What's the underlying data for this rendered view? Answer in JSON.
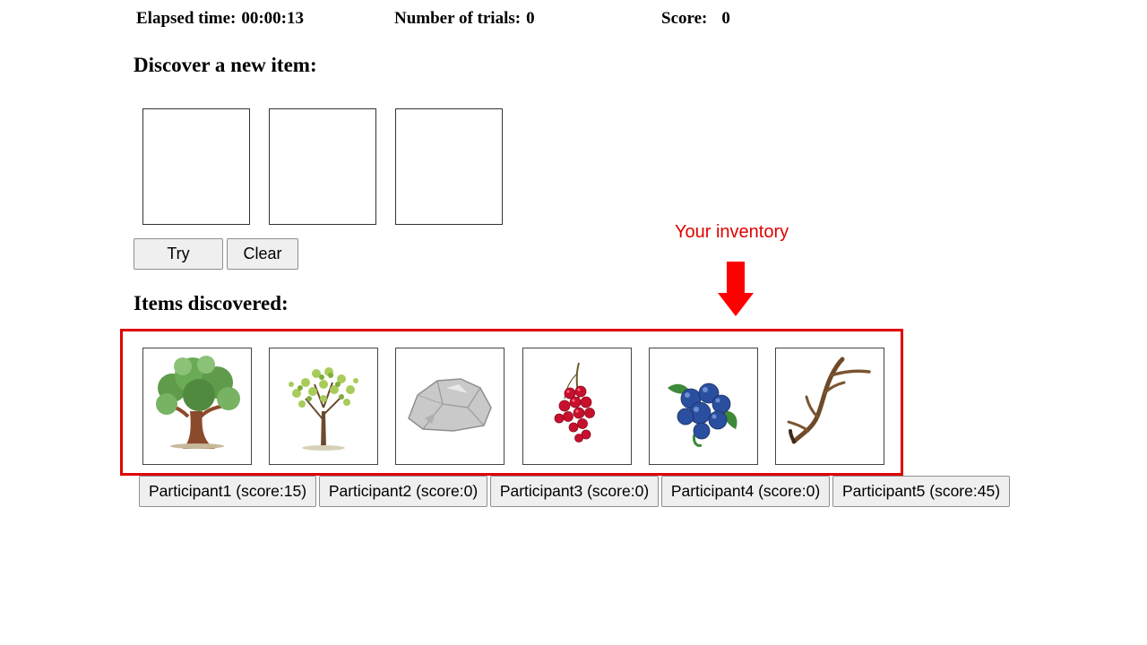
{
  "stats": {
    "elapsed_label": "Elapsed time:",
    "elapsed_value": "00:00:13",
    "trials_label": "Number of trials:",
    "trials_value": "0",
    "score_label": "Score:",
    "score_value": "0"
  },
  "discover": {
    "heading": "Discover a new item:",
    "try_label": "Try",
    "clear_label": "Clear"
  },
  "inventory": {
    "heading": "Items discovered:",
    "annotation": "Your inventory",
    "annotation_color": "#e00000",
    "items": [
      {
        "icon": "oak-tree-icon"
      },
      {
        "icon": "young-tree-icon"
      },
      {
        "icon": "rock-icon"
      },
      {
        "icon": "red-berries-icon"
      },
      {
        "icon": "blueberries-icon"
      },
      {
        "icon": "antler-icon"
      }
    ]
  },
  "participants": [
    {
      "label": "Participant1 (score:15)"
    },
    {
      "label": "Participant2 (score:0)"
    },
    {
      "label": "Participant3 (score:0)"
    },
    {
      "label": "Participant4 (score:0)"
    },
    {
      "label": "Participant5 (score:45)"
    }
  ]
}
